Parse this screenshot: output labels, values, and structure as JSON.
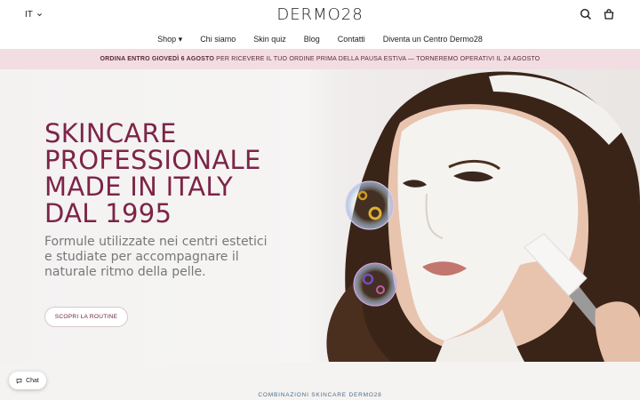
{
  "header": {
    "language": "IT",
    "logo": "DERMO28"
  },
  "nav": {
    "items": [
      {
        "label": "Shop ▾"
      },
      {
        "label": "Chi siamo"
      },
      {
        "label": "Skin quiz"
      },
      {
        "label": "Blog"
      },
      {
        "label": "Contatti"
      },
      {
        "label": "Diventa un Centro Dermo28"
      }
    ]
  },
  "announcement": {
    "bold": "ORDINA ENTRO GIOVEDÌ 6 AGOSTO",
    "rest": " PER RICEVERE IL TUO ORDINE PRIMA DELLA PAUSA ESTIVA — TORNEREMO OPERATIVI IL 24 AGOSTO"
  },
  "hero": {
    "headline_lines": [
      "SKINCARE",
      "PROFESSIONALE",
      "MADE IN ITALY",
      "DAL 1995"
    ],
    "subtitle": "Formule utilizzate nei centri estetici e studiate per accompagnare il naturale ritmo della pelle.",
    "cta": "SCOPRI LA ROUTINE"
  },
  "section": {
    "label": "COMBINAZIONI SKINCARE DERMO28"
  },
  "chat": {
    "label": "Chat"
  },
  "icons": {
    "search": "search-icon",
    "cart": "bag-icon",
    "chevron": "chevron-down-icon",
    "chat": "chat-bubble-icon"
  },
  "colors": {
    "brand": "#7d2448",
    "announce_bg": "#f2dde3"
  }
}
